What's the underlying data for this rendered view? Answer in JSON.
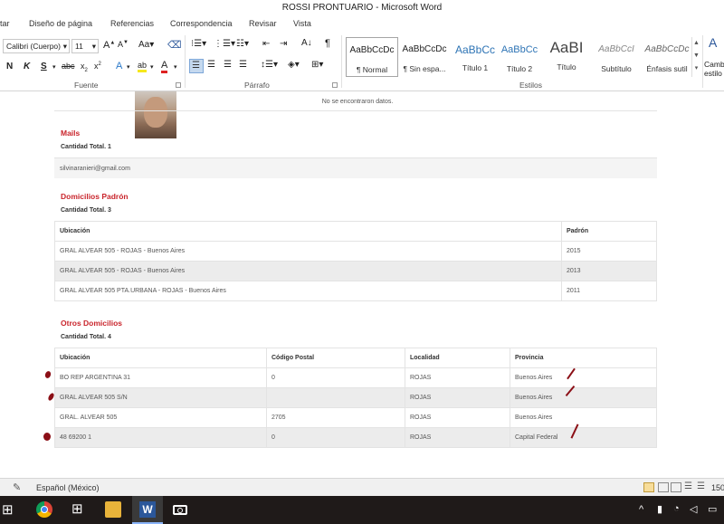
{
  "window": {
    "title": "ROSSI PRONTUARIO  -  Microsoft Word"
  },
  "tabs": [
    "tar",
    "Diseño de página",
    "Referencias",
    "Correspondencia",
    "Revisar",
    "Vista"
  ],
  "ribbon": {
    "font_name": "Calibri (Cuerpo)",
    "font_size": "11",
    "groups": {
      "fuente": "Fuente",
      "parrafo": "Párrafo",
      "estilos": "Estilos"
    },
    "styles": [
      {
        "preview": "AaBbCcDc",
        "name": "¶ Normal"
      },
      {
        "preview": "AaBbCcDc",
        "name": "¶ Sin espa..."
      },
      {
        "preview": "AaBbCc",
        "name": "Título 1"
      },
      {
        "preview": "AaBbCc",
        "name": "Título 2"
      },
      {
        "preview": "AaBI",
        "name": "Título"
      },
      {
        "preview": "AaBbCcI",
        "name": "Subtítulo"
      },
      {
        "preview": "AaBbCcDc",
        "name": "Énfasis sutil"
      }
    ],
    "change_styles": [
      "Camb",
      "estilo"
    ]
  },
  "document": {
    "no_data": "No se encontraron datos.",
    "mails": {
      "title": "Mails",
      "count": "Cantidad Total. 1",
      "email": "silvinaranieri@gmail.com"
    },
    "padron": {
      "title": "Domicilios Padrón",
      "count": "Cantidad Total. 3",
      "headers": [
        "Ubicación",
        "Padrón"
      ],
      "rows": [
        [
          "GRAL ALVEAR 505 - ROJAS - Buenos Aires",
          "2015"
        ],
        [
          "GRAL ALVEAR 505 - ROJAS - Buenos Aires",
          "2013"
        ],
        [
          "GRAL ALVEAR 505 PTA.URBANA - ROJAS - Buenos Aires",
          "2011"
        ]
      ]
    },
    "otros": {
      "title": "Otros Domicilios",
      "count": "Cantidad Total. 4",
      "headers": [
        "Ubicación",
        "Código Postal",
        "Localidad",
        "Provincia"
      ],
      "rows": [
        [
          "BO REP ARGENTINA 31",
          "0",
          "ROJAS",
          "Buenos Aires"
        ],
        [
          "GRAL ALVEAR 505 S/N",
          "",
          "ROJAS",
          "Buenos Aires"
        ],
        [
          "GRAL. ALVEAR 505",
          "2705",
          "ROJAS",
          "Buenos Aires"
        ],
        [
          "48 69200 1",
          "0",
          "ROJAS",
          "Capital Federal"
        ]
      ]
    }
  },
  "statusbar": {
    "language": "Español (México)",
    "zoom": "150"
  },
  "colors": {
    "section_title": "#c9252c",
    "word_blue": "#2b579a",
    "ink_mark": "#8b0f16"
  }
}
